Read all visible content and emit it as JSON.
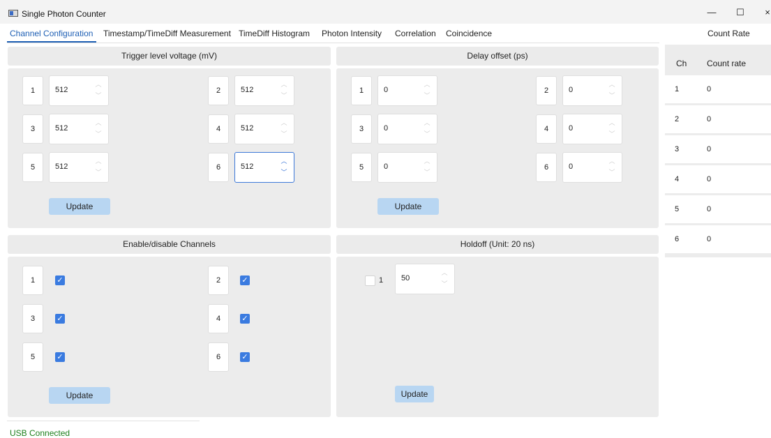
{
  "window": {
    "title": "Single Photon Counter",
    "minimize": "—",
    "maximize": "☐",
    "close": "×"
  },
  "tabs": [
    "Channel Configuration",
    "Timestamp/TimeDiff Measurement",
    "TimeDiff Histogram",
    "Photon Intensity",
    "Correlation",
    "Coincidence"
  ],
  "count_rate_tab": "Count Rate",
  "trigger": {
    "header": "Trigger level voltage (mV)",
    "channels": [
      {
        "ch": "1",
        "value": "512"
      },
      {
        "ch": "2",
        "value": "512"
      },
      {
        "ch": "3",
        "value": "512"
      },
      {
        "ch": "4",
        "value": "512"
      },
      {
        "ch": "5",
        "value": "512"
      },
      {
        "ch": "6",
        "value": "512"
      }
    ],
    "update_label": "Update"
  },
  "delay": {
    "header": "Delay offset (ps)",
    "channels": [
      {
        "ch": "1",
        "value": "0"
      },
      {
        "ch": "2",
        "value": "0"
      },
      {
        "ch": "3",
        "value": "0"
      },
      {
        "ch": "4",
        "value": "0"
      },
      {
        "ch": "5",
        "value": "0"
      },
      {
        "ch": "6",
        "value": "0"
      }
    ],
    "update_label": "Update"
  },
  "enable": {
    "header": "Enable/disable Channels",
    "channels": [
      {
        "ch": "1",
        "checked": true
      },
      {
        "ch": "2",
        "checked": true
      },
      {
        "ch": "3",
        "checked": true
      },
      {
        "ch": "4",
        "checked": true
      },
      {
        "ch": "5",
        "checked": true
      },
      {
        "ch": "6",
        "checked": true
      }
    ],
    "update_label": "Update"
  },
  "holdoff": {
    "header": "Holdoff (Unit: 20 ns)",
    "label": "1",
    "checked": false,
    "value": "50",
    "update_label": "Update"
  },
  "count_rate": {
    "col_ch": "Ch",
    "col_rate": "Count rate",
    "rows": [
      {
        "ch": "1",
        "rate": "0"
      },
      {
        "ch": "2",
        "rate": "0"
      },
      {
        "ch": "3",
        "rate": "0"
      },
      {
        "ch": "4",
        "rate": "0"
      },
      {
        "ch": "5",
        "rate": "0"
      },
      {
        "ch": "6",
        "rate": "0"
      }
    ]
  },
  "status": "USB Connected",
  "colors": {
    "accent": "#1e5fb4",
    "checkbox": "#3a7be0",
    "button": "#b8d6f2",
    "status": "#1a7f1a"
  }
}
